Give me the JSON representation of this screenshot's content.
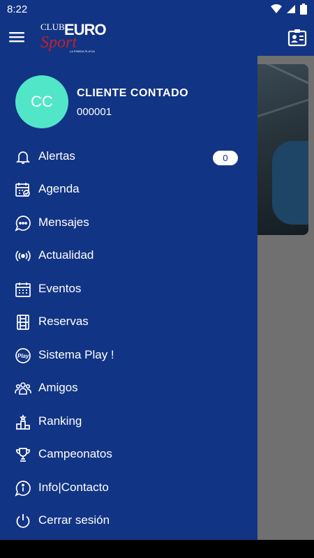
{
  "status": {
    "time": "8:22"
  },
  "header": {
    "logo_club": "CLUB",
    "logo_euro": "EURO",
    "logo_sport": "Sport",
    "logo_sub": "LA PINEDA PLATJA"
  },
  "user": {
    "initials": "CC",
    "name": "CLIENTE CONTADO",
    "code": "000001"
  },
  "alerts_count": "0",
  "menu": [
    {
      "label": "Alertas",
      "icon": "bell-icon"
    },
    {
      "label": "Agenda",
      "icon": "calendar-check-icon"
    },
    {
      "label": "Mensajes",
      "icon": "chat-bubble-icon"
    },
    {
      "label": "Actualidad",
      "icon": "broadcast-icon"
    },
    {
      "label": "Eventos",
      "icon": "calendar-grid-icon"
    },
    {
      "label": "Reservas",
      "icon": "court-icon"
    },
    {
      "label": "Sistema Play !",
      "icon": "play-badge-icon"
    },
    {
      "label": "Amigos",
      "icon": "friends-icon"
    },
    {
      "label": "Ranking",
      "icon": "podium-icon"
    },
    {
      "label": "Campeonatos",
      "icon": "trophy-icon"
    },
    {
      "label": "Info|Contacto",
      "icon": "info-icon"
    },
    {
      "label": "Cerrar sesión",
      "icon": "power-icon"
    }
  ]
}
